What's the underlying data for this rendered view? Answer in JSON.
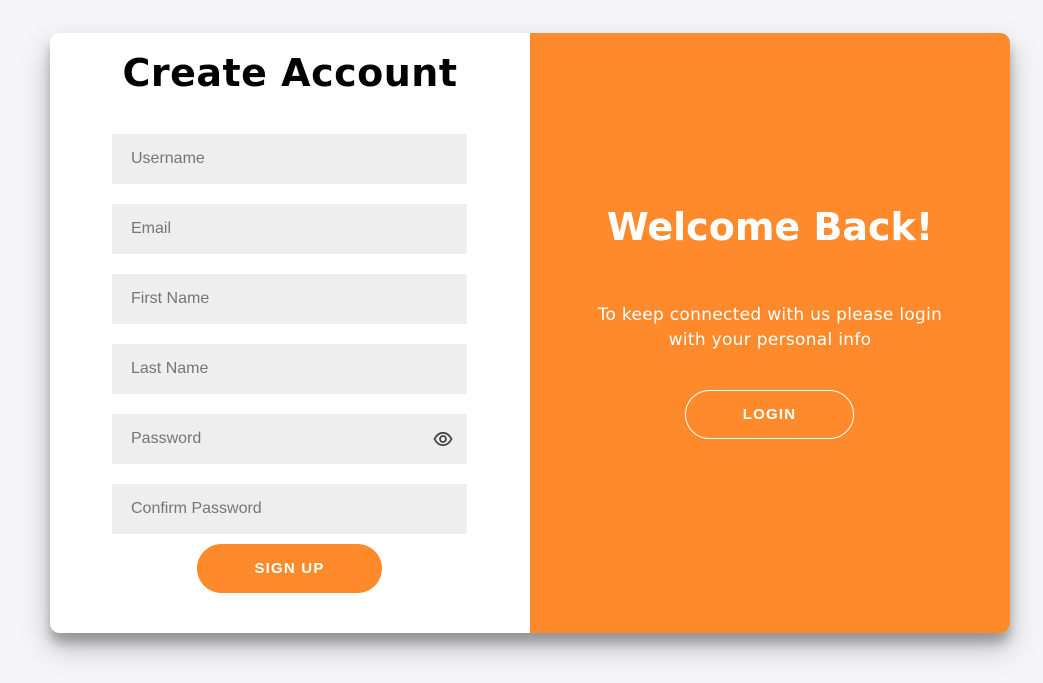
{
  "signup": {
    "title": "Create Account",
    "fields": {
      "username": {
        "placeholder": "Username",
        "value": ""
      },
      "email": {
        "placeholder": "Email",
        "value": ""
      },
      "first_name": {
        "placeholder": "First Name",
        "value": ""
      },
      "last_name": {
        "placeholder": "Last Name",
        "value": ""
      },
      "password": {
        "placeholder": "Password",
        "value": "",
        "toggle_icon": "eye-icon"
      },
      "confirm_password": {
        "placeholder": "Confirm Password",
        "value": ""
      }
    },
    "submit_label": "SIGN UP"
  },
  "welcome": {
    "title": "Welcome Back!",
    "text": "To keep connected with us please login with your personal info",
    "login_label": "LOGIN"
  },
  "colors": {
    "accent": "#ff8a2b",
    "input_bg": "#eeeeee",
    "page_bg": "#f5f5f7"
  }
}
